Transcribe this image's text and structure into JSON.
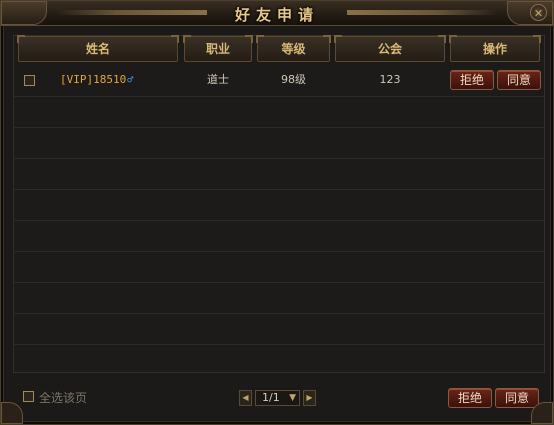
{
  "window": {
    "title": "好友申请",
    "close_symbol": "✕"
  },
  "table": {
    "headers": {
      "name": "姓名",
      "job": "职业",
      "level": "等级",
      "guild": "公会",
      "action": "操作"
    },
    "rows": [
      {
        "name": "[VIP]18510",
        "gender_icon": "male-icon",
        "gender_symbol": "♂",
        "job": "道士",
        "level": "98级",
        "guild": "123",
        "reject": "拒绝",
        "agree": "同意"
      }
    ]
  },
  "footer": {
    "select_all_label": "全选该页",
    "page": "1/1",
    "prev_symbol": "◀",
    "next_symbol": "▶",
    "dropdown_symbol": "▼",
    "reject": "拒绝",
    "agree": "同意"
  }
}
